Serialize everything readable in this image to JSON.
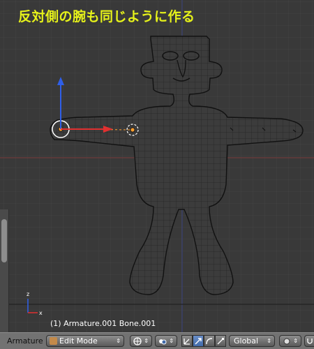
{
  "viewport": {
    "caption": "反対側の腕も同じように作る",
    "status_text": "(1) Armature.001 Bone.001"
  },
  "header": {
    "editor_label": "Armature",
    "mode_select": "Edit Mode",
    "transform_orientation": "Global"
  },
  "colors": {
    "caption": "#e6f21a",
    "viewport_bg": "#393939",
    "header_bg": "#727272",
    "selected_bone": "#ffa030",
    "widget_x": "#e03030",
    "widget_z": "#2f5fe8"
  }
}
